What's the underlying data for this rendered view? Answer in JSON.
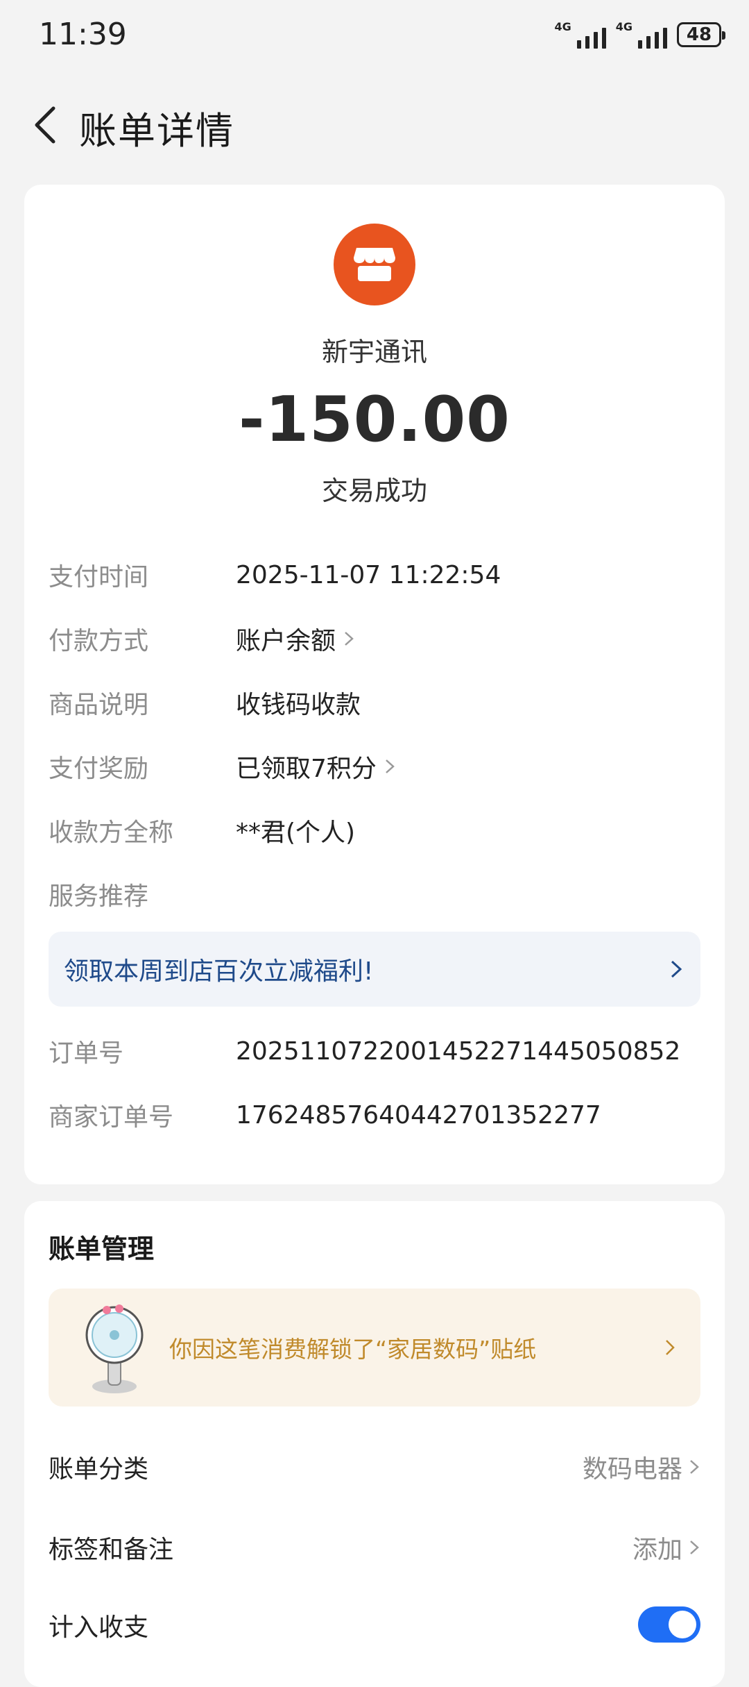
{
  "status_bar": {
    "time": "11:39",
    "network_1": "4G",
    "network_2": "4G",
    "battery": "48"
  },
  "header": {
    "title": "账单详情"
  },
  "merchant": {
    "name": "新宇通讯",
    "amount": "-150.00",
    "status": "交易成功",
    "logo_icon": "storefront-icon",
    "logo_color": "#e8541f"
  },
  "details": [
    {
      "label": "支付时间",
      "value": "2025-11-07 11:22:54"
    },
    {
      "label": "付款方式",
      "value": "账户余额"
    },
    {
      "label": "商品说明",
      "value": "收钱码收款"
    },
    {
      "label": "支付奖励",
      "value": "已领取7积分"
    },
    {
      "label": "收款方全称",
      "value": "**君(个人)"
    },
    {
      "label": "服务推荐",
      "value": ""
    }
  ],
  "promo": {
    "text": "领取本周到店百次立减福利!"
  },
  "order": [
    {
      "label": "订单号",
      "value": "2025110722001452271445050852"
    },
    {
      "label": "商家订单号",
      "value": "17624857640442701352277"
    }
  ],
  "manage": {
    "title": "账单管理",
    "sticker_text": "你因这笔消费解锁了“家居数码”贴纸",
    "rows": [
      {
        "label": "账单分类",
        "value": "数码电器"
      },
      {
        "label": "标签和备注",
        "value": "添加"
      },
      {
        "label": "计入收支",
        "value": ""
      }
    ]
  },
  "colors": {
    "accent_blue": "#1f6ef5",
    "promo_text": "#1f4a8a",
    "sticker_text": "#c08a2b"
  }
}
